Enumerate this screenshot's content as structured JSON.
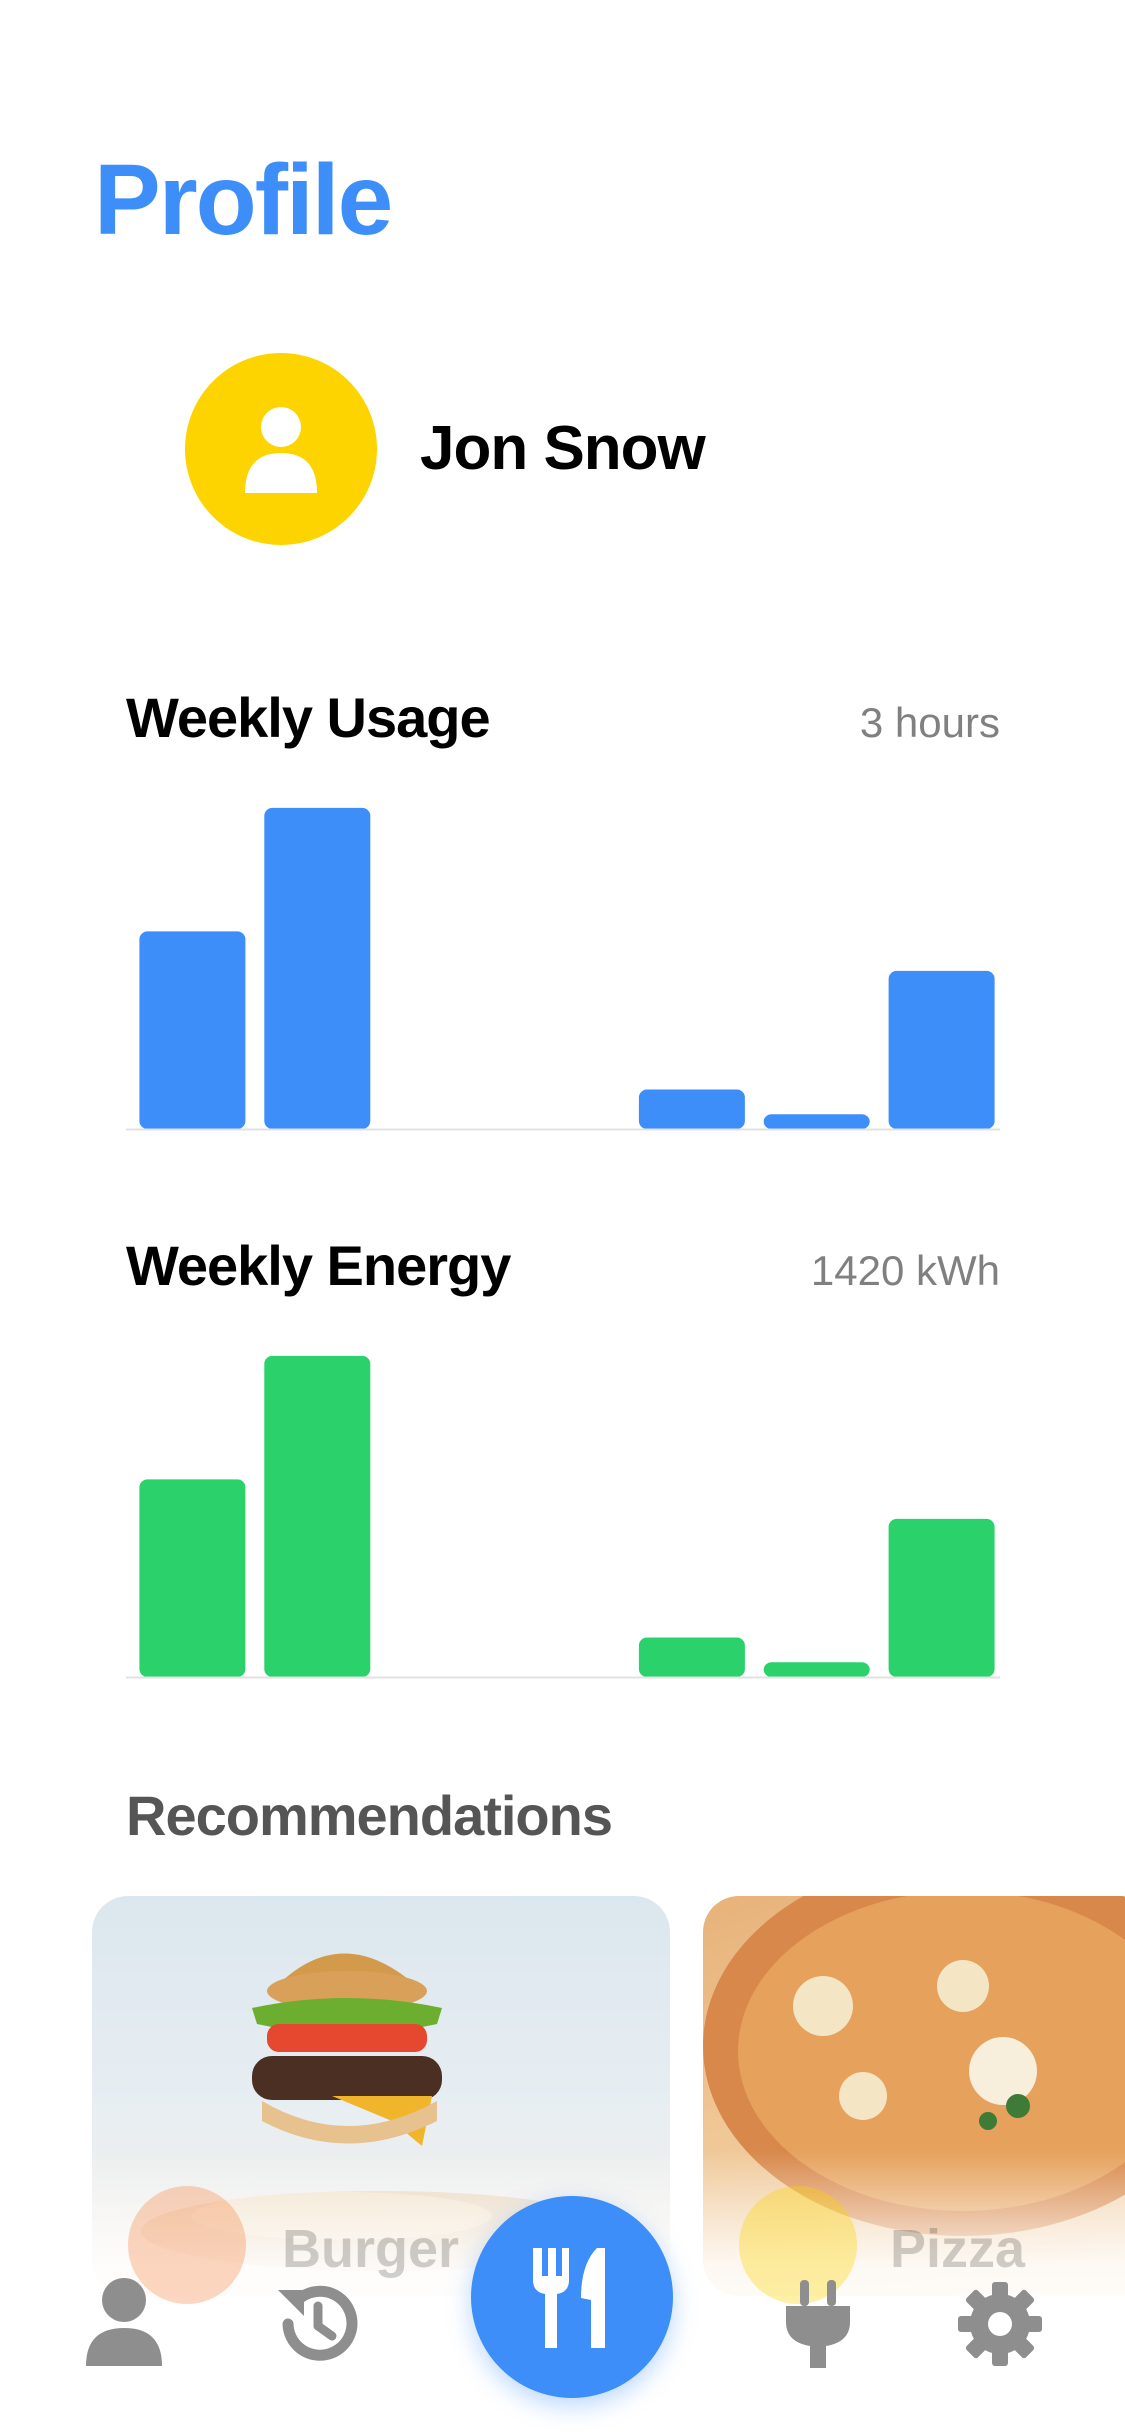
{
  "page": {
    "title": "Profile"
  },
  "user": {
    "name": "Jon Snow",
    "avatar_color": "#fdd400"
  },
  "usage": {
    "title": "Weekly Usage",
    "value": "3 hours",
    "color": "#3d8ef8"
  },
  "energy": {
    "title": "Weekly Energy",
    "value": "1420 kWh",
    "color": "#2bd26b"
  },
  "recommendations": {
    "title": "Recommendations",
    "items": [
      {
        "label": "Burger",
        "icon": "fork-knife-icon",
        "icon_color": "#f58a4b"
      },
      {
        "label": "Pizza",
        "icon": "fork-knife-icon",
        "icon_color": "#fdd400"
      }
    ]
  },
  "tab_bar": {
    "items": [
      {
        "name": "profile",
        "icon": "person-icon"
      },
      {
        "name": "history",
        "icon": "history-icon"
      },
      {
        "name": "food",
        "icon": "fork-knife-icon",
        "active": true
      },
      {
        "name": "energy",
        "icon": "plug-icon"
      },
      {
        "name": "settings",
        "icon": "gear-icon"
      }
    ],
    "accent": "#3d8ef8",
    "inactive_color": "#8e8e8e"
  },
  "chart_data": [
    {
      "type": "bar",
      "series": [
        {
          "values": [
            2.0,
            3.25,
            0,
            0,
            0.4,
            0.15,
            1.6
          ]
        }
      ],
      "ylim": [
        0,
        3.3
      ],
      "grid": false
    },
    {
      "type": "bar",
      "series": [
        {
          "values": [
            2.0,
            3.25,
            0,
            0,
            0.4,
            0.15,
            1.6
          ]
        }
      ],
      "ylim": [
        0,
        3.3
      ],
      "grid": false
    }
  ]
}
